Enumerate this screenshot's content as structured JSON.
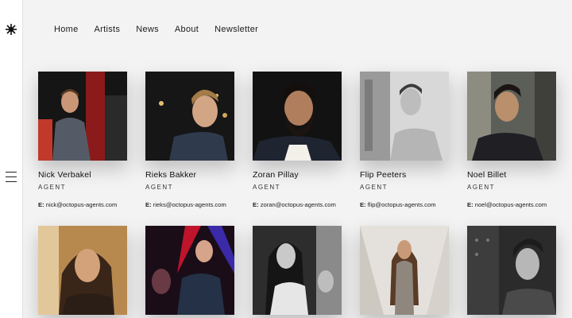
{
  "nav": {
    "items": [
      "Home",
      "Artists",
      "News",
      "About",
      "Newsletter"
    ]
  },
  "icons": {
    "logo": "octopus-logo-icon",
    "menu": "hamburger-menu-icon"
  },
  "colors": {
    "background": "#f3f3f3",
    "sidebar": "#ffffff",
    "text": "#1c1c1c"
  },
  "agents": [
    {
      "name": "Nick Verbakel",
      "role": "AGENT",
      "email_label": "E:",
      "email": "nick@octopus-agents.com"
    },
    {
      "name": "Rieks Bakker",
      "role": "AGENT",
      "email_label": "E:",
      "email": "rieks@octopus-agents.com"
    },
    {
      "name": "Zoran Pillay",
      "role": "AGENT",
      "email_label": "E:",
      "email": "zoran@octopus-agents.com"
    },
    {
      "name": "Flip Peeters",
      "role": "AGENT",
      "email_label": "E:",
      "email": "flip@octopus-agents.com"
    },
    {
      "name": "Noel Billet",
      "role": "AGENT",
      "email_label": "E:",
      "email": "noel@octopus-agents.com"
    }
  ]
}
